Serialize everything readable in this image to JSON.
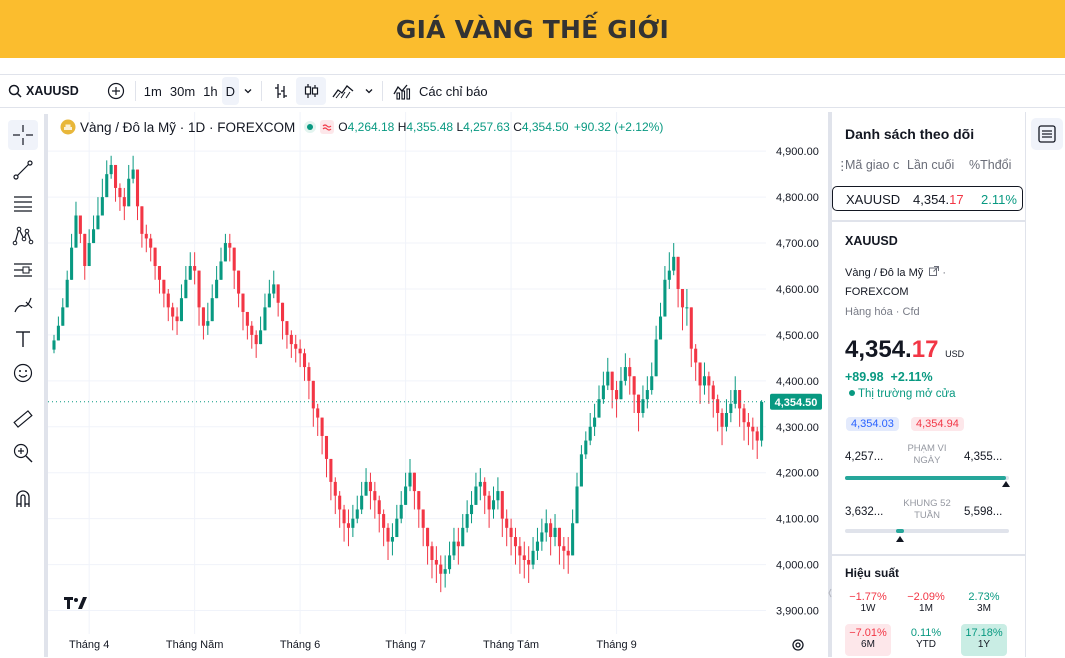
{
  "banner": {
    "title": "GIÁ VÀNG THẾ GIỚI"
  },
  "toolbar": {
    "symbol": "XAUUSD",
    "intervals": [
      "1m",
      "30m",
      "1h",
      "D"
    ],
    "indicators_label": "Các chỉ báo"
  },
  "legend": {
    "title": "Vàng / Đô la Mỹ · 1D · FOREXCOM",
    "o_label": "O",
    "o_value": "4,264.18",
    "h_label": "H",
    "h_value": "4,355.48",
    "l_label": "L",
    "l_value": "4,257.63",
    "c_label": "C",
    "c_value": "4,354.50",
    "change": "+90.32 (+2.12%)"
  },
  "colors": {
    "up": "#089981",
    "down": "#f23645",
    "banner": "#fbbd2e",
    "accent_blue": "#2962ff"
  },
  "chart_data": {
    "type": "candlestick",
    "x_ticks": [
      "Tháng 4",
      "Tháng Năm",
      "Tháng 6",
      "Tháng 7",
      "Tháng Tám",
      "Tháng 9"
    ],
    "y_ticks": [
      "4,900.00",
      "4,800.00",
      "4,700.00",
      "4,600.00",
      "4,500.00",
      "4,400.00",
      "4,300.00",
      "4,200.00",
      "4,100.00",
      "4,000.00",
      "3,900.00"
    ],
    "ylim": [
      3875,
      4920
    ],
    "last_price": 4354.5,
    "last_price_label": "4,354.50",
    "close": [
      4488,
      4520,
      4560,
      4620,
      4690,
      4760,
      4720,
      4650,
      4700,
      4730,
      4760,
      4800,
      4850,
      4870,
      4820,
      4800,
      4780,
      4840,
      4860,
      4780,
      4720,
      4710,
      4690,
      4650,
      4620,
      4590,
      4560,
      4540,
      4530,
      4580,
      4620,
      4650,
      4640,
      4560,
      4520,
      4530,
      4580,
      4620,
      4660,
      4700,
      4690,
      4640,
      4590,
      4550,
      4520,
      4500,
      4480,
      4510,
      4560,
      4590,
      4610,
      4570,
      4530,
      4500,
      4480,
      4470,
      4460,
      4430,
      4400,
      4340,
      4320,
      4280,
      4230,
      4180,
      4150,
      4120,
      4090,
      4080,
      4100,
      4120,
      4150,
      4180,
      4160,
      4140,
      4110,
      4080,
      4050,
      4060,
      4100,
      4130,
      4170,
      4200,
      4160,
      4120,
      4080,
      4040,
      4010,
      4000,
      3980,
      3990,
      4020,
      4050,
      4040,
      4080,
      4110,
      4130,
      4170,
      4180,
      4150,
      4120,
      4140,
      4160,
      4100,
      4080,
      4060,
      4040,
      4020,
      4010,
      4000,
      4030,
      4050,
      4070,
      4090,
      4060,
      4080,
      4040,
      4030,
      4020,
      4090,
      4170,
      4240,
      4270,
      4300,
      4320,
      4360,
      4390,
      4420,
      4380,
      4360,
      4400,
      4430,
      4410,
      4370,
      4330,
      4360,
      4380,
      4410,
      4490,
      4540,
      4620,
      4640,
      4670,
      4600,
      4560,
      4560,
      4470,
      4440,
      4390,
      4410,
      4390,
      4360,
      4330,
      4300,
      4330,
      4350,
      4380,
      4340,
      4310,
      4300,
      4290,
      4270,
      4354
    ],
    "high": [
      4500,
      4540,
      4580,
      4640,
      4720,
      4790,
      4760,
      4700,
      4730,
      4760,
      4800,
      4840,
      4880,
      4890,
      4860,
      4830,
      4820,
      4870,
      4890,
      4830,
      4760,
      4740,
      4720,
      4690,
      4650,
      4620,
      4600,
      4570,
      4560,
      4610,
      4650,
      4680,
      4680,
      4610,
      4560,
      4570,
      4610,
      4650,
      4690,
      4720,
      4720,
      4680,
      4630,
      4580,
      4550,
      4530,
      4510,
      4540,
      4590,
      4620,
      4640,
      4610,
      4570,
      4530,
      4510,
      4500,
      4490,
      4470,
      4440,
      4380,
      4350,
      4320,
      4270,
      4220,
      4190,
      4160,
      4130,
      4120,
      4130,
      4150,
      4180,
      4210,
      4200,
      4180,
      4150,
      4120,
      4090,
      4090,
      4130,
      4160,
      4200,
      4230,
      4200,
      4160,
      4120,
      4080,
      4050,
      4040,
      4020,
      4020,
      4050,
      4080,
      4080,
      4110,
      4140,
      4160,
      4200,
      4210,
      4190,
      4160,
      4170,
      4190,
      4150,
      4120,
      4100,
      4080,
      4060,
      4050,
      4040,
      4060,
      4080,
      4100,
      4120,
      4100,
      4110,
      4080,
      4060,
      4060,
      4120,
      4200,
      4260,
      4290,
      4330,
      4350,
      4390,
      4420,
      4450,
      4420,
      4400,
      4430,
      4460,
      4450,
      4410,
      4370,
      4390,
      4410,
      4440,
      4520,
      4570,
      4650,
      4680,
      4700,
      4650,
      4600,
      4600,
      4520,
      4480,
      4430,
      4440,
      4420,
      4400,
      4370,
      4340,
      4360,
      4380,
      4410,
      4380,
      4350,
      4330,
      4320,
      4300,
      4358
    ],
    "low": [
      4460,
      4490,
      4530,
      4600,
      4670,
      4730,
      4700,
      4620,
      4680,
      4700,
      4740,
      4780,
      4820,
      4840,
      4790,
      4770,
      4750,
      4820,
      4830,
      4750,
      4690,
      4680,
      4660,
      4620,
      4590,
      4560,
      4530,
      4510,
      4500,
      4550,
      4590,
      4620,
      4610,
      4520,
      4490,
      4500,
      4550,
      4590,
      4630,
      4670,
      4660,
      4600,
      4560,
      4510,
      4490,
      4470,
      4450,
      4480,
      4530,
      4560,
      4580,
      4540,
      4490,
      4470,
      4450,
      4440,
      4430,
      4400,
      4360,
      4300,
      4280,
      4240,
      4190,
      4140,
      4110,
      4080,
      4050,
      4040,
      4060,
      4090,
      4110,
      4150,
      4120,
      4100,
      4070,
      4040,
      4010,
      4020,
      4060,
      4090,
      4130,
      4160,
      4120,
      4080,
      4040,
      4000,
      3970,
      3960,
      3940,
      3950,
      3980,
      4010,
      4000,
      4040,
      4070,
      4090,
      4130,
      4140,
      4110,
      4080,
      4100,
      4120,
      4060,
      4040,
      4020,
      4000,
      3980,
      3970,
      3960,
      3990,
      4010,
      4030,
      4050,
      4020,
      4040,
      4000,
      3990,
      3980,
      4040,
      4130,
      4200,
      4230,
      4260,
      4280,
      4320,
      4350,
      4380,
      4340,
      4320,
      4360,
      4390,
      4370,
      4330,
      4290,
      4320,
      4340,
      4370,
      4450,
      4500,
      4580,
      4600,
      4630,
      4560,
      4510,
      4520,
      4430,
      4400,
      4350,
      4370,
      4350,
      4320,
      4290,
      4260,
      4290,
      4310,
      4340,
      4300,
      4270,
      4260,
      4250,
      4230,
      4257
    ]
  },
  "watchlist": {
    "title": "Danh sách theo dõi",
    "col_symbol": "Mã giao c",
    "col_last": "Lần cuối",
    "col_change": "%Thđổi",
    "row": {
      "symbol": "XAUUSD",
      "last_main": "4,354.",
      "last_frac": "17",
      "change": "2.11%"
    }
  },
  "details": {
    "symbol": "XAUUSD",
    "name": "Vàng / Đô la Mỹ",
    "exchange": "FOREXCOM",
    "category": "Hàng hóa",
    "type": "Cfd",
    "price_main": "4,354.",
    "price_frac": "17",
    "currency": "USD",
    "change_abs": "+89.98",
    "change_pct": "+2.11%",
    "market_status": "Thị trường mở cửa",
    "bid": "4,354.03",
    "ask": "4,354.94",
    "day_low": "4,257...",
    "day_label_1": "PHẠM VI",
    "day_label_2": "NGÀY",
    "day_high": "4,355...",
    "day_fraction": 0.98,
    "week_low": "3,632...",
    "week_label_1": "KHUNG 52",
    "week_label_2": "TUẦN",
    "week_high": "5,598...",
    "week_fraction": 0.37,
    "performance_title": "Hiệu suất",
    "performance": [
      {
        "value": "−1.77%",
        "label": "1W",
        "dir": "down"
      },
      {
        "value": "−2.09%",
        "label": "1M",
        "dir": "down"
      },
      {
        "value": "2.73%",
        "label": "3M",
        "dir": "up"
      },
      {
        "value": "−7.01%",
        "label": "6M",
        "dir": "down"
      },
      {
        "value": "0.11%",
        "label": "YTD",
        "dir": "up"
      },
      {
        "value": "17.18%",
        "label": "1Y",
        "dir": "up"
      }
    ]
  }
}
